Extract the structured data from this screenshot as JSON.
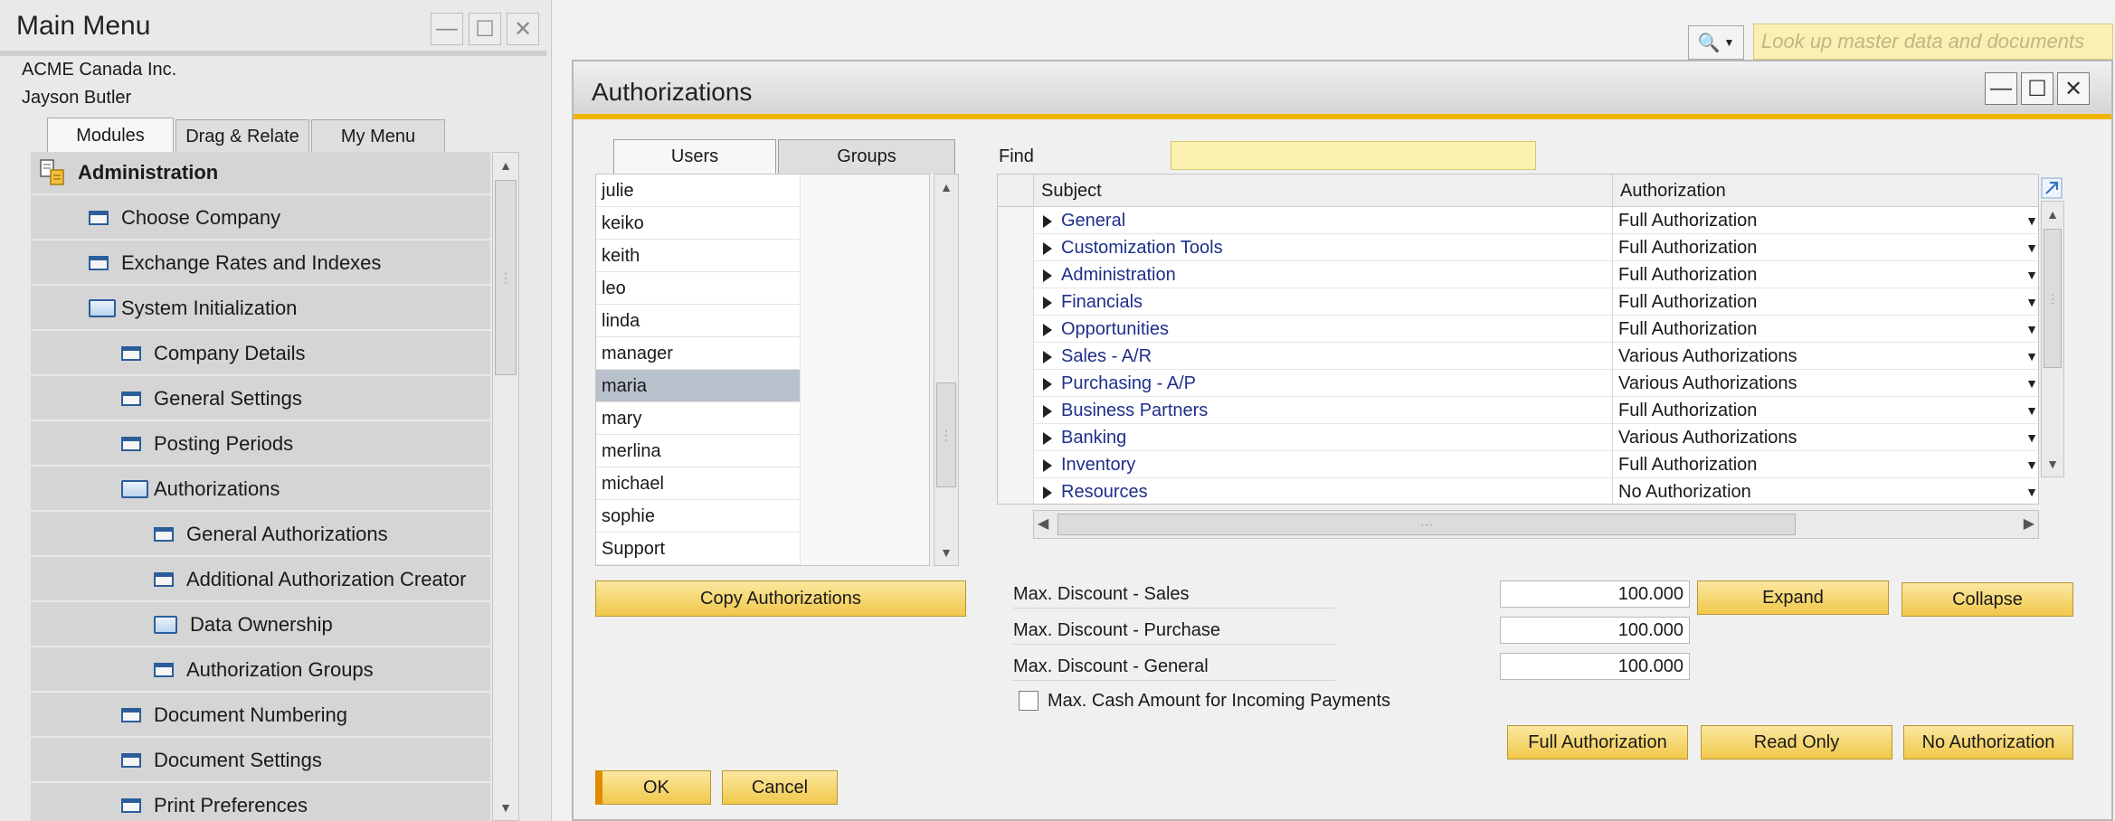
{
  "main_menu": {
    "title": "Main Menu",
    "company": "ACME Canada Inc.",
    "user": "Jayson Butler",
    "tabs": [
      {
        "label": "Modules"
      },
      {
        "label": "Drag & Relate"
      },
      {
        "label": "My Menu"
      }
    ],
    "items": [
      {
        "label": "Administration",
        "icon": "administration-icon"
      },
      {
        "label": "Choose Company",
        "icon": "window-icon"
      },
      {
        "label": "Exchange Rates and Indexes",
        "icon": "window-icon"
      },
      {
        "label": "System Initialization",
        "icon": "open-folder-icon"
      },
      {
        "label": "Company Details",
        "icon": "window-icon"
      },
      {
        "label": "General Settings",
        "icon": "window-icon"
      },
      {
        "label": "Posting Periods",
        "icon": "window-icon"
      },
      {
        "label": "Authorizations",
        "icon": "open-folder-icon"
      },
      {
        "label": "General Authorizations",
        "icon": "window-icon"
      },
      {
        "label": "Additional Authorization Creator",
        "icon": "window-icon"
      },
      {
        "label": "Data Ownership",
        "icon": "folder-icon"
      },
      {
        "label": "Authorization Groups",
        "icon": "window-icon"
      },
      {
        "label": "Document Numbering",
        "icon": "window-icon"
      },
      {
        "label": "Document Settings",
        "icon": "window-icon"
      },
      {
        "label": "Print Preferences",
        "icon": "window-icon"
      }
    ]
  },
  "search": {
    "placeholder": "Look up master data and documents"
  },
  "auth": {
    "title": "Authorizations",
    "tabs": [
      {
        "label": "Users"
      },
      {
        "label": "Groups"
      }
    ],
    "users": [
      "julie",
      "keiko",
      "keith",
      "leo",
      "linda",
      "manager",
      "maria",
      "mary",
      "merlina",
      "michael",
      "sophie",
      "Support"
    ],
    "selected_user": "maria",
    "copy_button": "Copy Authorizations",
    "find_label": "Find",
    "columns": {
      "subject": "Subject",
      "authorization": "Authorization"
    },
    "rows": [
      {
        "subject": "General",
        "authorization": "Full Authorization"
      },
      {
        "subject": "Customization Tools",
        "authorization": "Full Authorization"
      },
      {
        "subject": "Administration",
        "authorization": "Full Authorization"
      },
      {
        "subject": "Financials",
        "authorization": "Full Authorization"
      },
      {
        "subject": "Opportunities",
        "authorization": "Full Authorization"
      },
      {
        "subject": "Sales - A/R",
        "authorization": "Various Authorizations"
      },
      {
        "subject": "Purchasing - A/P",
        "authorization": "Various Authorizations"
      },
      {
        "subject": "Business Partners",
        "authorization": "Full Authorization"
      },
      {
        "subject": "Banking",
        "authorization": "Various Authorizations"
      },
      {
        "subject": "Inventory",
        "authorization": "Full Authorization"
      },
      {
        "subject": "Resources",
        "authorization": "No Authorization"
      }
    ],
    "discounts": [
      {
        "label": "Max. Discount - Sales",
        "value": "100.000"
      },
      {
        "label": "Max. Discount - Purchase",
        "value": "100.000"
      },
      {
        "label": "Max. Discount - General",
        "value": "100.000"
      }
    ],
    "cash_label": "Max. Cash Amount for Incoming Payments",
    "buttons": {
      "expand": "Expand",
      "collapse": "Collapse",
      "full": "Full Authorization",
      "read_only": "Read Only",
      "no_auth": "No Authorization",
      "ok": "OK",
      "cancel": "Cancel"
    }
  },
  "colors": {
    "accent": "#f0b400",
    "button_gold": "#f1c84b",
    "selected_row": "#b9c1cc",
    "link_blue": "#1f2f8a"
  }
}
